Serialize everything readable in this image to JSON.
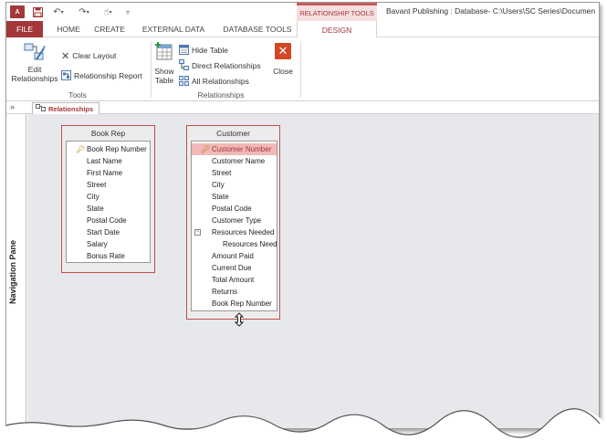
{
  "title_bar": {
    "app_icon": "A",
    "context_header": "RELATIONSHIP TOOLS",
    "window_title": "Bavant Publishing : Database- C:\\Users\\SC Series\\Documen"
  },
  "tabs": {
    "file": "FILE",
    "home": "HOME",
    "create": "CREATE",
    "external": "EXTERNAL DATA",
    "dbtools": "DATABASE TOOLS",
    "design": "DESIGN"
  },
  "ribbon": {
    "tools": {
      "edit_relationships": [
        "Edit",
        "Relationships"
      ],
      "clear_layout": "Clear Layout",
      "relationship_report": "Relationship Report",
      "label": "Tools"
    },
    "relationships": {
      "show_table": [
        "Show",
        "Table"
      ],
      "hide_table": "Hide Table",
      "direct_relationships": "Direct Relationships",
      "all_relationships": "All Relationships",
      "close": "Close",
      "label": "Relationships"
    }
  },
  "doc_tab": "Relationships",
  "nav_toggle": "»",
  "nav_pane_label": "Navigation Pane",
  "tables": {
    "book_rep": {
      "title": "Book Rep",
      "fields": [
        "Book Rep Number",
        "Last Name",
        "First Name",
        "Street",
        "City",
        "State",
        "Postal Code",
        "Start Date",
        "Salary",
        "Bonus Rate"
      ]
    },
    "customer": {
      "title": "Customer",
      "fields": [
        "Customer Number",
        "Customer Name",
        "Street",
        "City",
        "State",
        "Postal Code",
        "Customer Type",
        "Resources Needed",
        "Resources Need",
        "Amount Paid",
        "Current Due",
        "Total Amount",
        "Returns",
        "Book Rep Number"
      ]
    }
  },
  "colors": {
    "access_red": "#a4373a",
    "table_border": "#c0504d",
    "selected_field": "#f1b8b7",
    "canvas": "#e7e8ec"
  }
}
